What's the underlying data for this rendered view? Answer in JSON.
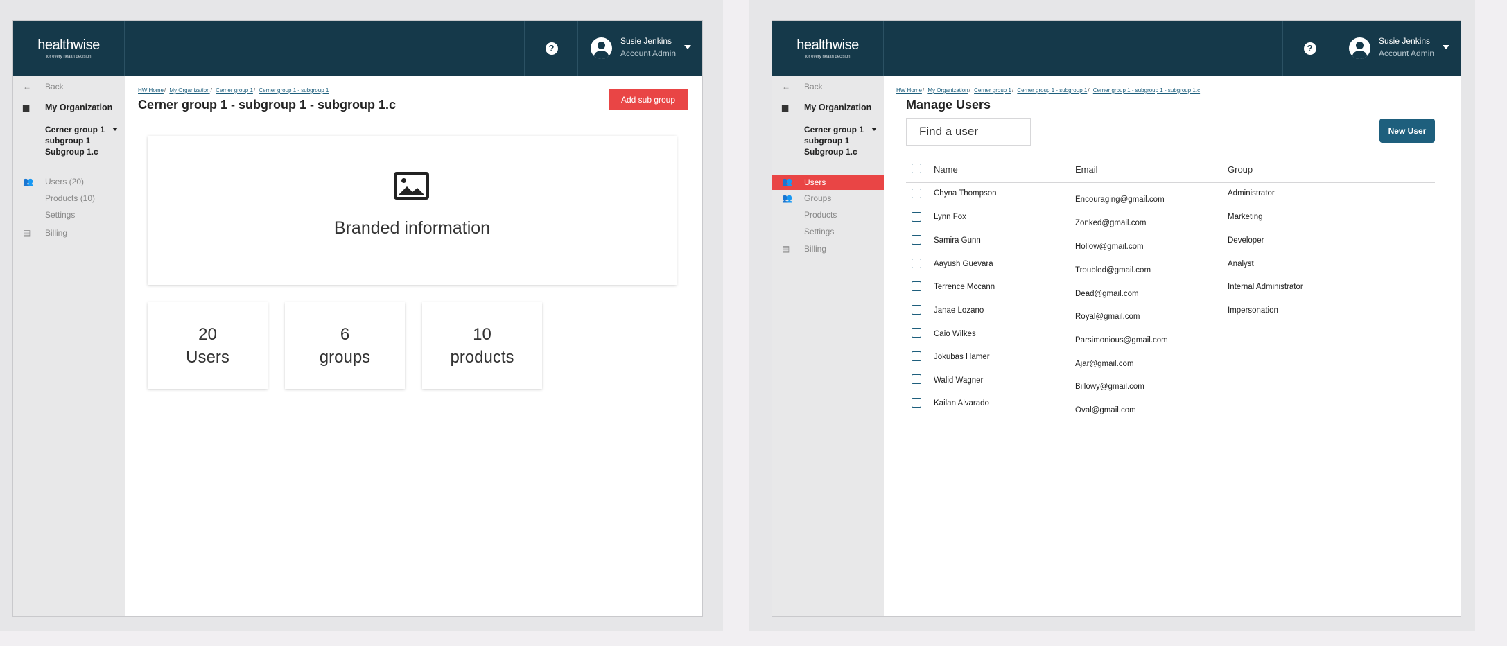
{
  "brand": {
    "name": "healthwise",
    "tagline": "for every health decision"
  },
  "header": {
    "help_icon": "question-circle-icon",
    "user_name": "Susie Jenkins",
    "user_role": "Account Admin"
  },
  "left": {
    "sidebar": {
      "back": "Back",
      "org": "My Organization",
      "subgroup_lines": [
        "Cerner group 1",
        "subgroup 1",
        "Subgroup 1.c"
      ],
      "users": "Users (20)",
      "products": "Products (10)",
      "settings": "Settings",
      "billing": "Billing"
    },
    "breadcrumbs": [
      "HW Home",
      "My Organization",
      "Cerner group 1",
      "Cerner group 1 - subgroup 1"
    ],
    "title": "Cerner group 1 - subgroup 1 - subgroup 1.c",
    "add_button": "Add sub group",
    "branded": "Branded information",
    "stats": [
      {
        "value": "20",
        "label": "Users"
      },
      {
        "value": "6",
        "label": "groups"
      },
      {
        "value": "10",
        "label": "products"
      }
    ]
  },
  "right": {
    "sidebar": {
      "back": "Back",
      "org": "My Organization",
      "subgroup_lines": [
        "Cerner group 1",
        "subgroup 1",
        "Subgroup 1.c"
      ],
      "users": "Users",
      "groups": "Groups",
      "products": "Products",
      "settings": "Settings",
      "billing": "Billing"
    },
    "breadcrumbs": [
      "HW Home",
      "My Organization",
      "Cerner group 1",
      "Cerner group 1 - subgroup 1",
      "Cerner group 1 - subgroup 1 - subgroup 1.c"
    ],
    "title": "Manage Users",
    "search_placeholder": "Find a user",
    "new_user_button": "New User",
    "columns": [
      "Name",
      "Email",
      "Group"
    ],
    "names": [
      "Chyna Thompson",
      "Lynn Fox",
      "Samira Gunn",
      "Aayush Guevara",
      "Terrence Mccann",
      "Janae Lozano",
      "Caio Wilkes",
      "Jokubas Hamer",
      "Walid Wagner",
      "Kailan Alvarado"
    ],
    "emails": [
      "Encouraging@gmail.com",
      "Zonked@gmail.com",
      "Hollow@gmail.com",
      "Troubled@gmail.com",
      "Dead@gmail.com",
      "Royal@gmail.com",
      "Parsimonious@gmail.com",
      "Ajar@gmail.com",
      "Billowy@gmail.com",
      "Oval@gmail.com"
    ],
    "groups": [
      "Administrator",
      "Marketing",
      "Developer",
      "Analyst",
      "Internal Administrator",
      "Impersonation"
    ]
  }
}
